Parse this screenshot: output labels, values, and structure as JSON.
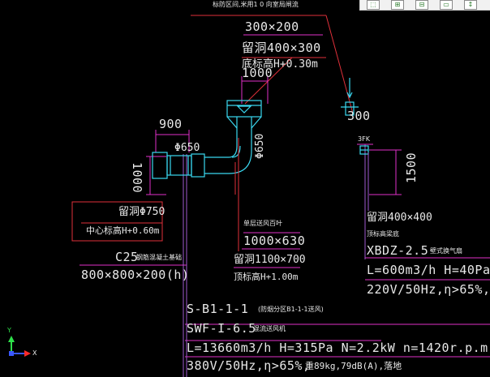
{
  "top": {
    "clipped_note": "标防区间,米用1 0 向室局闸流",
    "dim_300x200": "300×200"
  },
  "upper_labels": {
    "opening_400x300": "留洞400×300",
    "floor_elev": "底标高H+0.30m",
    "dim_1000": "1000",
    "dim_300": "300",
    "dim_900": "900",
    "dim_phi650_h": "Φ650",
    "dim_phi650_v": "Φ650",
    "dim_1000_v": "1000",
    "dim_1500": "1500",
    "dim_small": "3FK"
  },
  "left_box": {
    "line1": "留洞Φ750",
    "line2": "中心标高H+0.60m"
  },
  "foundation": {
    "c25": "C25",
    "c25_note": "钢筋混凝土基础",
    "size": "800×800×200(h)"
  },
  "center_duct": {
    "title": "单层送风百叶",
    "size": "1000×630",
    "opening": "留洞1100×700",
    "elev": "顶标高H+1.00m"
  },
  "right_block": {
    "opening": "留洞400×400",
    "elev": "顶标高梁底",
    "model": "XBDZ-2.5",
    "model_note": "壁式换气扇",
    "spec1": "L=600m3/h H=40Pa",
    "spec2": "220V/50Hz,η>65%,"
  },
  "bottom_block": {
    "code": "S-B1-1-1",
    "code_note": "(防烟分区B1-1-1送风)",
    "fan": "SWF-I-6.5",
    "fan_note": "混流送风机",
    "spec1": "L=13660m3/h H=315Pa N=2.2kW n=1420r.p.m",
    "spec2": "380V/50Hz,η>65%,",
    "spec2b": "重89kg,79dB(A),落地"
  },
  "ucs": {
    "y": "Y",
    "x": "X"
  },
  "toolbar": {
    "items": [
      "⬚",
      "⊞",
      "⊟",
      "▭",
      "↕"
    ]
  },
  "colors": {
    "background": "#000000",
    "text": "#e8e8e8",
    "duct_cyan": "#3ad8f0",
    "dim_magenta": "#e030c8",
    "leader_red": "#e0303a",
    "wall_purple": "#a05ad0",
    "ucs_blue": "#3a58ff",
    "ucs_green": "#2ee04a",
    "ucs_red": "#ff2a2a"
  }
}
